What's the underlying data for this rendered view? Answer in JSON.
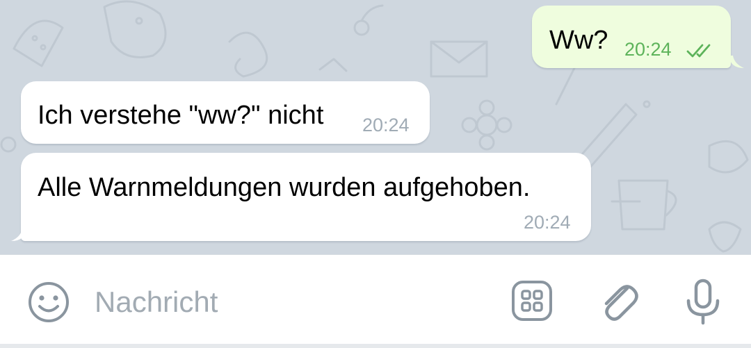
{
  "messages": [
    {
      "direction": "outgoing",
      "text": "Ww?",
      "time": "20:24",
      "status": "read",
      "status_icon": "double-check-icon"
    },
    {
      "direction": "incoming",
      "text": "Ich verstehe \"ww?\" nicht",
      "time": "20:24"
    },
    {
      "direction": "incoming",
      "text": "Alle Warnmeldungen wurden aufgehoben.",
      "time": "20:24"
    }
  ],
  "composer": {
    "placeholder": "Nachricht",
    "value": "",
    "icons": [
      "emoji-icon",
      "bot-commands-icon",
      "paperclip-icon",
      "microphone-icon"
    ]
  },
  "colors": {
    "chat_background": "#cfd7df",
    "outgoing_bubble": "#effdde",
    "incoming_bubble": "#ffffff",
    "outgoing_time": "#5db35a",
    "incoming_time": "#a0abb5",
    "icon_gray": "#8a959f"
  }
}
